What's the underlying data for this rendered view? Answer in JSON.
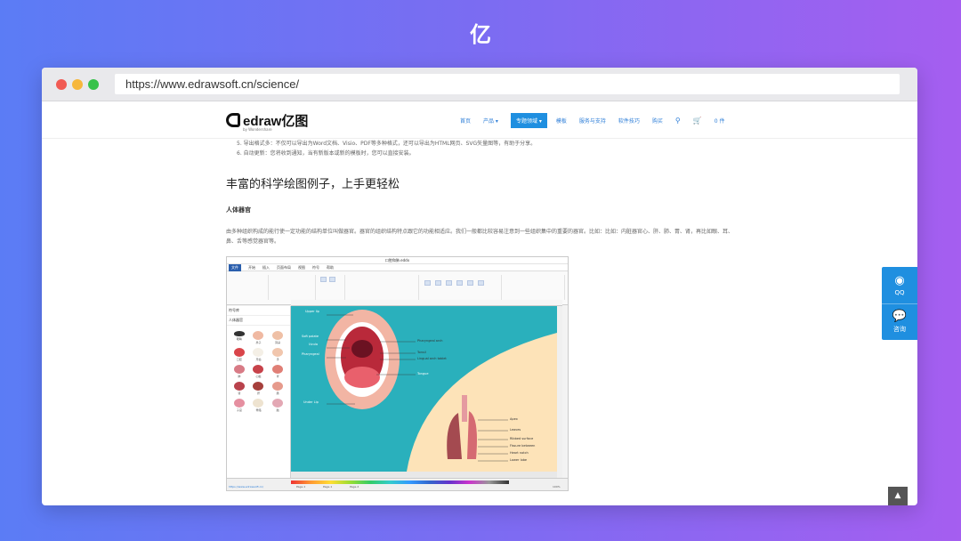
{
  "browser": {
    "url": "https://www.edrawsoft.cn/science/"
  },
  "site": {
    "brand": "edraw亿图",
    "brand_sub": "by Wondershare",
    "nav": [
      "首页",
      "产品 ▾",
      "专题领域 ▾",
      "模板",
      "服务与支持",
      "软件技巧",
      "购买"
    ],
    "cart": "0 件"
  },
  "content": {
    "list_line_1": "5. 导出格式多：不仅可以导出为Word文档、Visio、PDF等多种格式，还可以导出为HTML网页、SVG矢量图等，有助于分享。",
    "list_line_2": "6. 自动更新：您将收到通知，当有新版本或新的模板时，您可以直接安装。",
    "section_title": "丰富的科学绘图例子，上手更轻松",
    "sub_title": "人体器官",
    "paragraph": "由多种组织构成的能行使一定功能的结构单位叫做器官。器官的组织结构特点跟它的功能相适应。我们一般都比较容易注意到一些组织集中的重要的器官。比如：比如：内脏器官心、肝、肺、胃、肾，再比如眼、耳、鼻、舌等感觉器官等。"
  },
  "screenshot": {
    "window_title": "口腔和肺.eddx",
    "tabs": [
      "文件",
      "开始",
      "插入",
      "页面布局",
      "视图",
      "符号",
      "帮助"
    ],
    "left_panel_title": "符号库",
    "left_panel_category": "人体器官",
    "organs": [
      "眼睛",
      "鼻子",
      "耳朵",
      "口腔",
      "牙齿",
      "手",
      "肺",
      "心脏",
      "胃",
      "肾",
      "肝",
      "肠",
      "子宫",
      "骨骼",
      "脑"
    ],
    "labels": {
      "upper_lip": "Upper lip",
      "soft_palate": "Soft palate",
      "uvula": "Uvula",
      "pharyngeal": "Pharyngeal",
      "pharyngeal_arch": "Pharyngeal arch",
      "tonsil": "Tonsil",
      "lingual_arch": "Lingual arch tablet",
      "tongue": "Tongue",
      "under_lip": "Under Lip",
      "apex": "Apex",
      "leaves": "Leaves",
      "ribbed_surface": "Ribbed surface",
      "fissure": "Fissure between",
      "heart_notch": "Heart notch",
      "lower_lobe": "Lower lobe"
    },
    "page_tabs": [
      "Page-1",
      "Page-1",
      "Page-2"
    ],
    "status_url": "https://www.edrawsoft.cn/",
    "zoom": "100%"
  },
  "sidebar": {
    "qq_label": "QQ",
    "chat_label": "咨询"
  },
  "colors": {
    "accent": "#1f8fe0",
    "page_bg": "#2ab0bc",
    "lung_bg": "#fde3b8"
  }
}
